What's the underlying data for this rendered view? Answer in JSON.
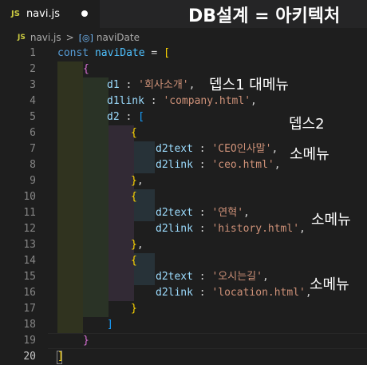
{
  "tab": {
    "badge": "JS",
    "filename": "navi.js"
  },
  "overlay_title": "DB설계 = 아키텍처",
  "breadcrumb": {
    "file_badge": "JS",
    "file": "navi.js",
    "separator": ">",
    "symbol_icon": "[◎]",
    "symbol": "naviDate"
  },
  "line_numbers": [
    "1",
    "2",
    "3",
    "4",
    "5",
    "6",
    "7",
    "8",
    "9",
    "10",
    "11",
    "12",
    "13",
    "14",
    "15",
    "16",
    "17",
    "18",
    "19",
    "20"
  ],
  "code": {
    "l1": {
      "kw": "const",
      "name": "naviDate",
      "eq": " = ",
      "br": "["
    },
    "l2": {
      "br": "{"
    },
    "l3": {
      "key": "d1",
      "colon": " : ",
      "val": "'회사소개'",
      "comma": ","
    },
    "l4": {
      "key": "d1link",
      "colon": " : ",
      "val": "'company.html'",
      "comma": ","
    },
    "l5": {
      "key": "d2",
      "colon": " : ",
      "br": "["
    },
    "l6": {
      "br": "{"
    },
    "l7": {
      "key": "d2text",
      "colon": " : ",
      "val": "'CEO인사말'",
      "comma": ","
    },
    "l8": {
      "key": "d2link",
      "colon": " : ",
      "val": "'ceo.html'",
      "comma": ","
    },
    "l9": {
      "br": "}",
      "comma": ","
    },
    "l10": {
      "br": "{"
    },
    "l11": {
      "key": "d2text",
      "colon": " : ",
      "val": "'연혁'",
      "comma": ","
    },
    "l12": {
      "key": "d2link",
      "colon": " : ",
      "val": "'history.html'",
      "comma": ","
    },
    "l13": {
      "br": "}",
      "comma": ","
    },
    "l14": {
      "br": "{"
    },
    "l15": {
      "key": "d2text",
      "colon": " : ",
      "val": "'오시는길'",
      "comma": ","
    },
    "l16": {
      "key": "d2link",
      "colon": " : ",
      "val": "'location.html'",
      "comma": ","
    },
    "l17": {
      "br": "}"
    },
    "l18": {
      "br": "]"
    },
    "l19": {
      "br": "}"
    },
    "l20": {
      "br": "]"
    }
  },
  "annotations": {
    "depth1_menu": "뎁스1 대메뉴",
    "depth2": "뎁스2",
    "submenu_1": "소메뉴",
    "submenu_2": "소메뉴",
    "submenu_3": "소메뉴"
  },
  "active_line": "20",
  "colors": {
    "keyword": "#569cd6",
    "constant": "#4fc1ff",
    "property": "#9cdcfe",
    "string": "#ce9178",
    "bracket_level1": "#ffd700",
    "bracket_level2": "#da70d6",
    "bracket_level3": "#179fff"
  }
}
